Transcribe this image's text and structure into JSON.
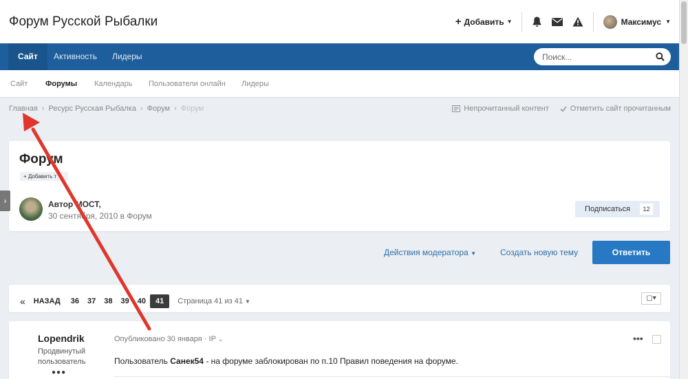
{
  "header": {
    "site_title": "Форум Русской Рыбалки",
    "add_label": "Добавить",
    "user_name": "Максимус"
  },
  "nav": {
    "items": [
      {
        "label": "Сайт",
        "active": true
      },
      {
        "label": "Активность",
        "active": false
      },
      {
        "label": "Лидеры",
        "active": false
      }
    ],
    "search_placeholder": "Поиск..."
  },
  "subnav": {
    "items": [
      {
        "label": "Сайт",
        "active": false
      },
      {
        "label": "Форумы",
        "active": true
      },
      {
        "label": "Календарь",
        "active": false
      },
      {
        "label": "Пользователи онлайн",
        "active": false
      },
      {
        "label": "Лидеры",
        "active": false
      }
    ]
  },
  "breadcrumb": {
    "items": [
      "Главная",
      "Ресурс Русская Рыбалка",
      "Форум",
      "Форум"
    ],
    "unread_label": "Непрочитанный контент",
    "mark_read_label": "Отметить сайт прочитанным"
  },
  "topic": {
    "title": "Форум",
    "tag_button": "Добавить т",
    "author_line": "Автор МОСТ,",
    "date_line": "30 сентября, 2010 в Форум",
    "follow_label": "Подписаться",
    "follow_count": "12"
  },
  "actions": {
    "moderator_label": "Действия модератора",
    "new_topic_label": "Создать новую тему",
    "reply_label": "Ответить"
  },
  "pagination": {
    "first": "«",
    "back": "НАЗАД",
    "pages": [
      "36",
      "37",
      "38",
      "39",
      "40"
    ],
    "current": "41",
    "total_label": "Страница 41 из 41"
  },
  "post": {
    "author": "Lopendrik",
    "role_line1": "Продвинутый",
    "role_line2": "пользователь",
    "meta": "Опубликовано 30 января · IP",
    "body_prefix": "Пользователь ",
    "body_user": "Санек54",
    "body_suffix": " - на форуме заблокирован по п.10 Правил поведения на форуме."
  },
  "colors": {
    "navbar": "#1f5e9c",
    "accent": "#2879c3",
    "annotation_arrow": "#e0362c"
  },
  "icons": [
    "plus-icon",
    "bell-icon",
    "envelope-icon",
    "warning-icon",
    "search-icon",
    "check-icon",
    "unread-icon"
  ]
}
